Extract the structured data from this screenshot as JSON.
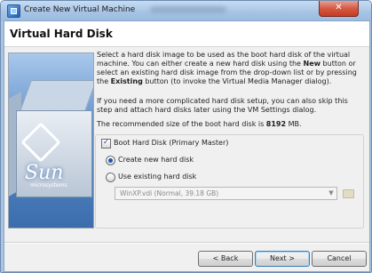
{
  "window": {
    "title": "Create New Virtual Machine",
    "close_label": "✕"
  },
  "header": {
    "title": "Virtual Hard Disk"
  },
  "art": {
    "brand": "Sun",
    "brand_sub": "microsystems"
  },
  "description": {
    "p1_a": "Select a hard disk image to be used as the boot hard disk of the virtual machine. You can either create a new hard disk using the ",
    "p1_new": "New",
    "p1_b": " button or select an existing hard disk image from the drop-down list or by pressing the ",
    "p1_existing": "Existing",
    "p1_c": " button (to invoke the Virtual Media Manager dialog).",
    "p2": "If you need a more complicated hard disk setup, you can also skip this step and attach hard disks later using the VM Settings dialog.",
    "recommend_a": "The recommended size of the boot hard disk is ",
    "recommend_size": "8192",
    "recommend_b": " MB."
  },
  "options": {
    "boot_hd_label": "Boot Hard Disk (Primary Master)",
    "create_new_label": "Create new hard disk",
    "use_existing_label": "Use existing hard disk",
    "existing_combo_value": "WinXP.vdi (Normal, 39.18 GB)"
  },
  "buttons": {
    "back": "< Back",
    "next": "Next >",
    "cancel": "Cancel"
  }
}
